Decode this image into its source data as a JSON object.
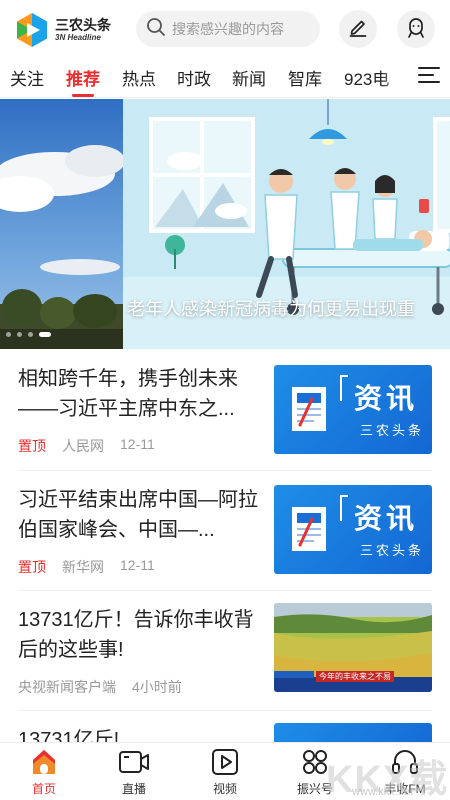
{
  "header": {
    "logo_cn": "三农头条",
    "logo_en": "3N Headline",
    "search_placeholder": "搜索感兴趣的内容"
  },
  "tabs": [
    {
      "label": "关注",
      "active": false
    },
    {
      "label": "推荐",
      "active": true
    },
    {
      "label": "热点",
      "active": false
    },
    {
      "label": "时政",
      "active": false
    },
    {
      "label": "新闻",
      "active": false
    },
    {
      "label": "智库",
      "active": false
    },
    {
      "label": "923电",
      "active": false
    }
  ],
  "banner": {
    "caption": "老年人感染新冠病毒为何更易出现重"
  },
  "feed": [
    {
      "title": "相知跨千年，携手创未来——习近平主席中东之...",
      "pin": "置顶",
      "source": "人民网",
      "time": "12-11",
      "thumb_word": "资讯",
      "thumb_sub": "三农头条"
    },
    {
      "title": "习近平结束出席中国—阿拉伯国家峰会、中国—...",
      "pin": "置顶",
      "source": "新华网",
      "time": "12-11",
      "thumb_word": "资讯",
      "thumb_sub": "三农头条"
    },
    {
      "title": "13731亿斤！告诉你丰收背后的这些事!",
      "pin": "",
      "source": "央视新闻客户端",
      "time": "4小时前",
      "thumb_caption": "今年的丰收来之不易"
    },
    {
      "title": "13731亿斤!"
    }
  ],
  "bottom_nav": [
    {
      "label": "首页",
      "icon": "home-icon",
      "active": true
    },
    {
      "label": "直播",
      "icon": "live-camera-icon",
      "active": false
    },
    {
      "label": "视频",
      "icon": "video-play-icon",
      "active": false
    },
    {
      "label": "振兴号",
      "icon": "revitalize-icon",
      "active": false
    },
    {
      "label": "丰收FM",
      "icon": "headphones-icon",
      "active": false
    }
  ],
  "watermark": {
    "text": "KKX载",
    "url": "www.kkx.net"
  },
  "colors": {
    "accent": "#e83030",
    "thumb_blue": "#1a7fe0",
    "muted_text": "#999999"
  }
}
